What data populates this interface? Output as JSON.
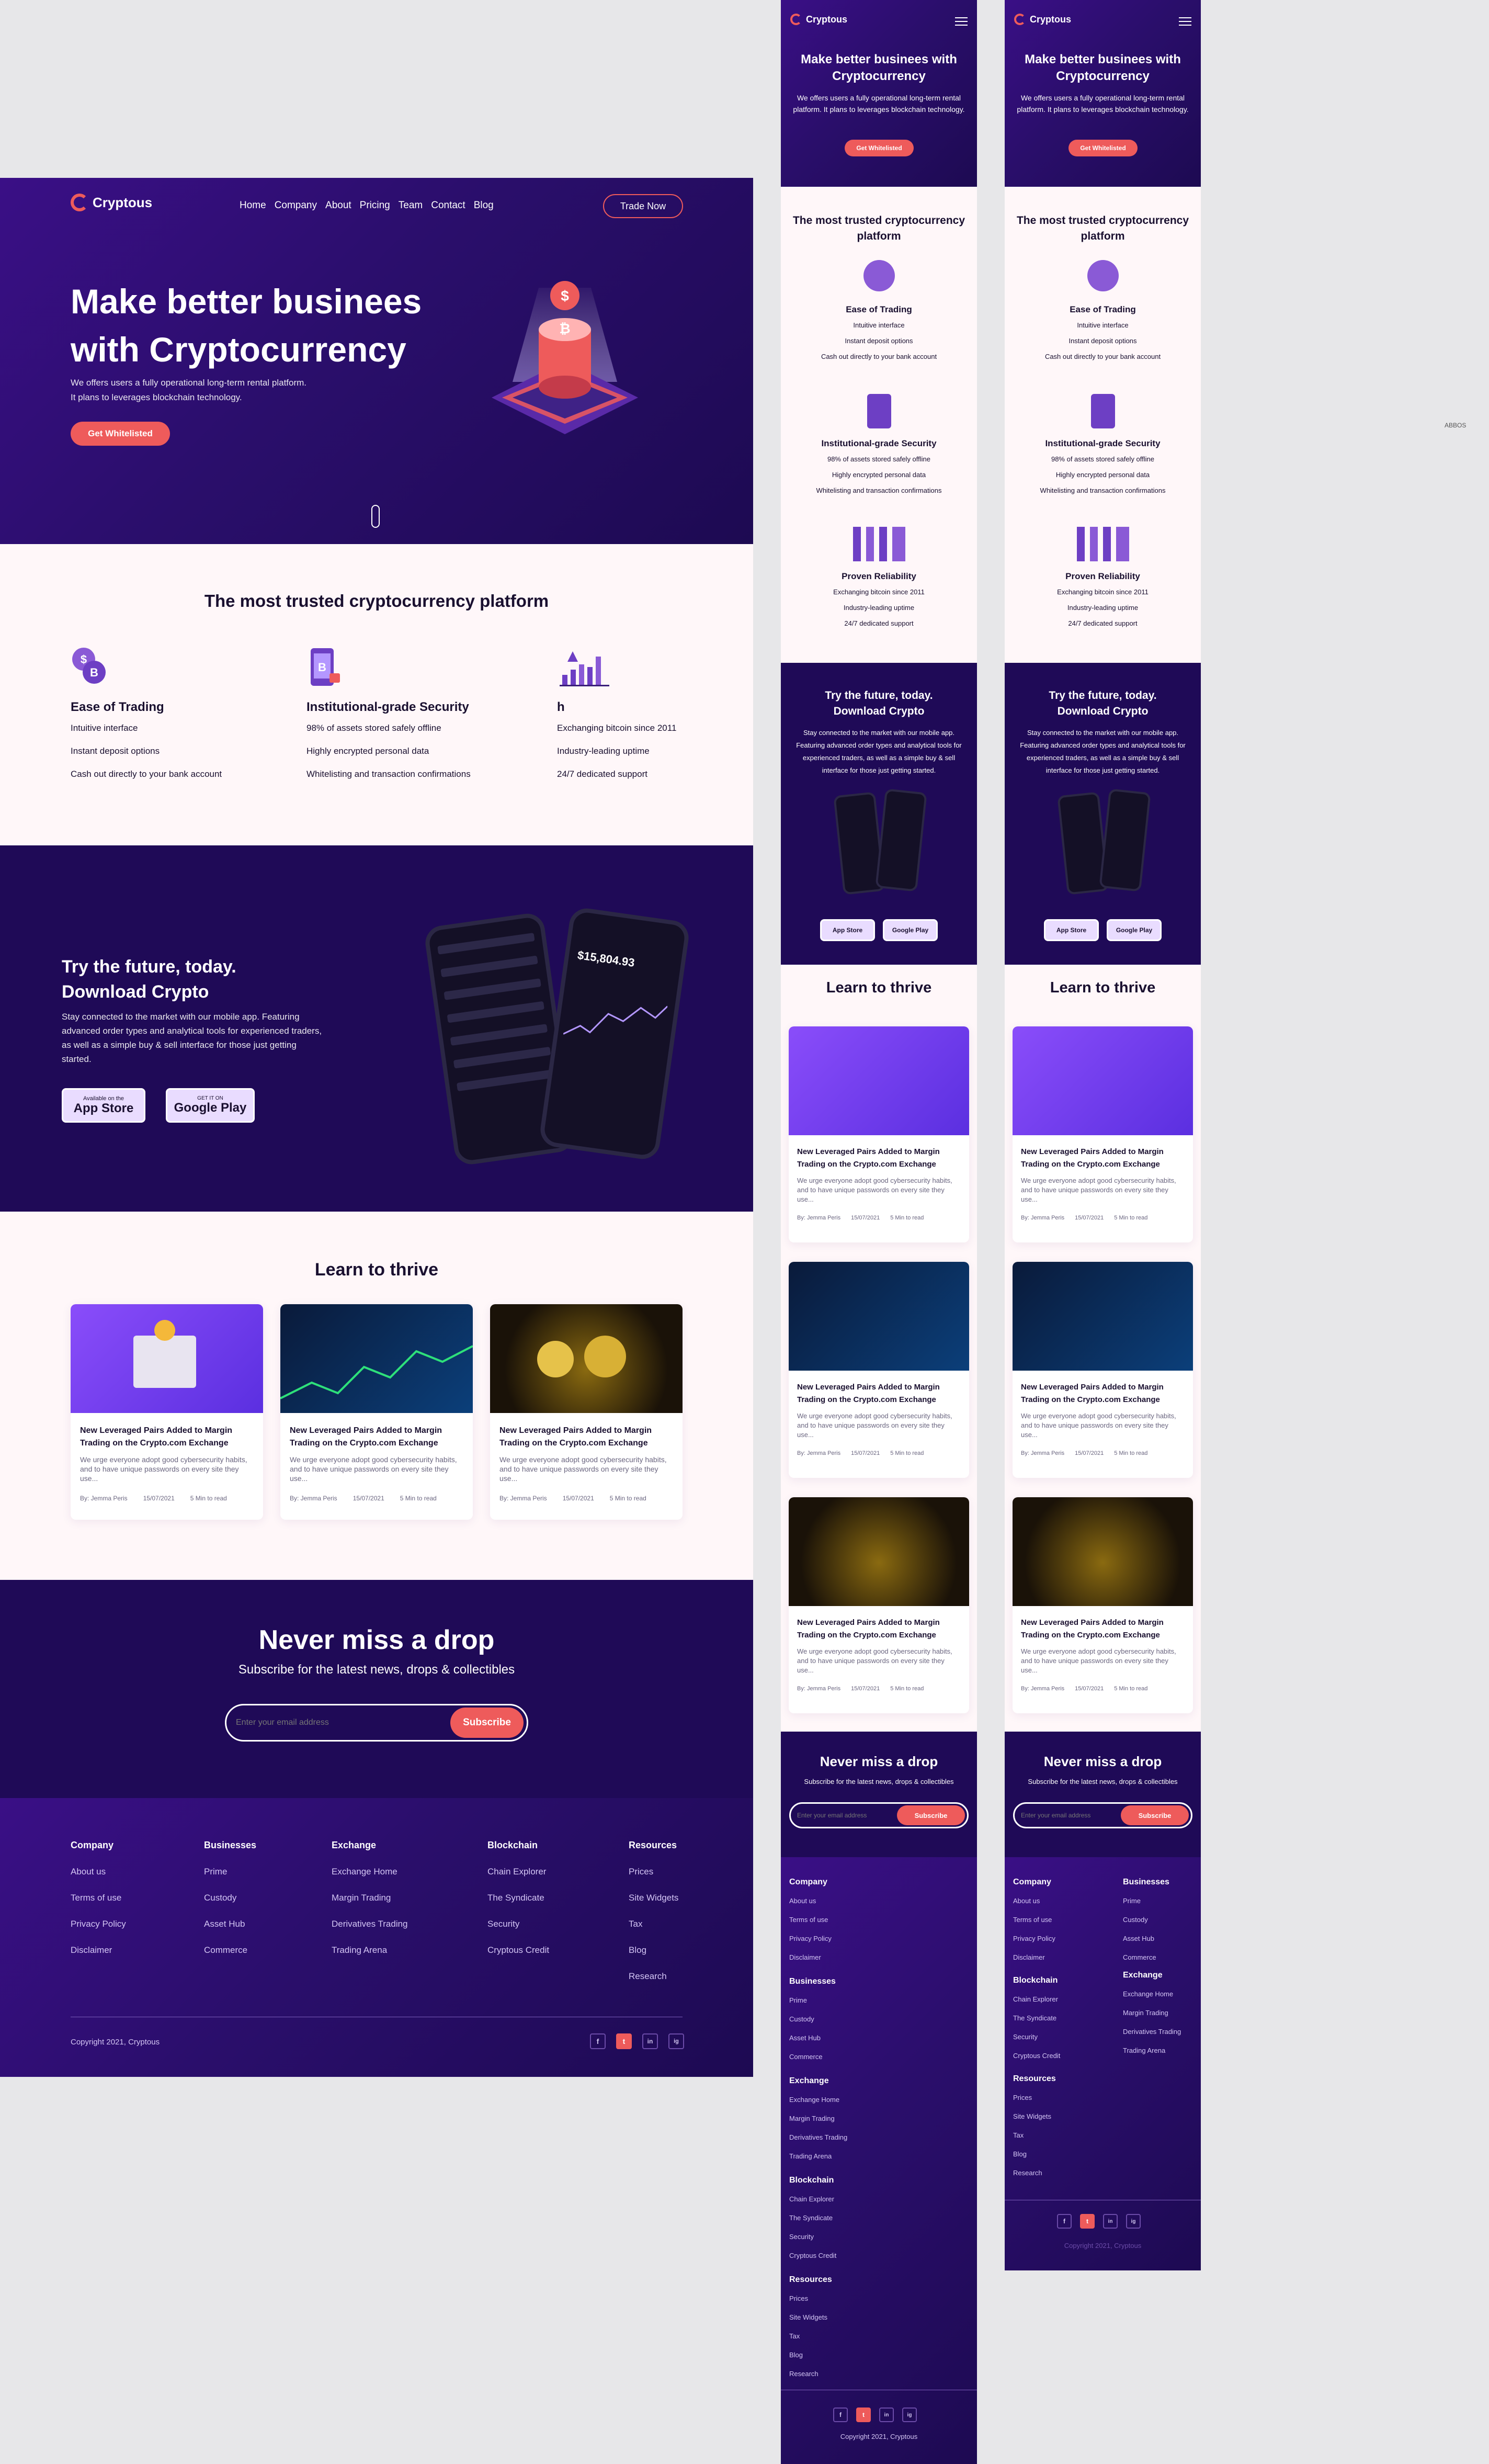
{
  "brand": {
    "name": "Cryptous"
  },
  "nav": {
    "items": [
      "Home",
      "Company",
      "About",
      "Pricing",
      "Team",
      "Contact",
      "Blog"
    ],
    "cta": "Trade Now"
  },
  "hero": {
    "title_line1": "Make better businees",
    "title_line2": "with Cryptocurrency",
    "mobile_title": "Make better businees with Cryptocurrency",
    "subtitle_line1": "We offers users a fully operational long-term rental platform.",
    "subtitle_line2": "It plans to leverages blockchain technology.",
    "mobile_subtitle": "We offers users a fully operational long-term rental platform. It plans to leverages blockchain technology.",
    "cta": "Get Whitelisted"
  },
  "features": {
    "heading": "The most trusted cryptocurrency platform",
    "items": [
      {
        "title": "Ease of Trading",
        "icon": "coins-icon",
        "lines": [
          "Intuitive interface",
          "Instant deposit options",
          "Cash out directly to your bank account"
        ]
      },
      {
        "title": "Institutional-grade Security",
        "icon": "phone-lock-icon",
        "lines": [
          "98% of assets stored safely offline",
          "Highly encrypted personal data",
          "Whitelisting and transaction confirmations"
        ]
      },
      {
        "title": "Proven Reliability",
        "desktop_title": "h",
        "icon": "rocket-chart-icon",
        "lines": [
          "Exchanging bitcoin since 2011",
          "Industry-leading uptime",
          "24/7 dedicated support"
        ]
      }
    ]
  },
  "app": {
    "title_line1": "Try the future, today.",
    "title_line2": "Download Crypto",
    "text": "Stay connected to the market with our mobile app. Featuring advanced order types and analytical tools for experienced traders, as well as a simple buy & sell interface for those just getting started.",
    "app_store": {
      "small": "Available on the",
      "big": "App Store"
    },
    "google_play": {
      "small": "GET IT ON",
      "big": "Google Play"
    },
    "phone_price": "$15,804.93"
  },
  "learn": {
    "heading": "Learn to thrive",
    "cards": [
      {
        "title": "New Leveraged Pairs Added to Margin Trading on the Crypto.com Exchange",
        "text": "We urge everyone adopt good cybersecurity habits, and to have unique passwords on every site they use...",
        "author": "By: Jemma Peris",
        "date": "15/07/2021",
        "read": "5 Min to read",
        "img": "coins-stack"
      },
      {
        "title": "New Leveraged Pairs Added to Margin Trading on the Crypto.com Exchange",
        "text": "We urge everyone adopt good cybersecurity habits, and to have unique passwords on every site they use...",
        "author": "By: Jemma Peris",
        "date": "15/07/2021",
        "read": "5 Min to read",
        "img": "trading-phone"
      },
      {
        "title": "New Leveraged Pairs Added to Margin Trading on the Crypto.com Exchange",
        "text": "We urge everyone adopt good cybersecurity habits, and to have unique passwords on every site they use...",
        "author": "By: Jemma Peris",
        "date": "15/07/2021",
        "read": "5 Min to read",
        "img": "gold-coins"
      }
    ]
  },
  "subscribe": {
    "heading": "Never miss a drop",
    "text": "Subscribe for the latest news, drops & collectibles",
    "placeholder": "Enter your email address",
    "button": "Subscribe"
  },
  "footer": {
    "columns": [
      {
        "title": "Company",
        "links": [
          "About us",
          "Terms of use",
          "Privacy Policy",
          "Disclaimer"
        ]
      },
      {
        "title": "Businesses",
        "links": [
          "Prime",
          "Custody",
          "Asset Hub",
          "Commerce"
        ]
      },
      {
        "title": "Exchange",
        "links": [
          "Exchange Home",
          "Margin Trading",
          "Derivatives Trading",
          "Trading Arena"
        ]
      },
      {
        "title": "Blockchain",
        "links": [
          "Chain Explorer",
          "The Syndicate",
          "Security",
          "Cryptous Credit"
        ]
      },
      {
        "title": "Resources",
        "links": [
          "Prices",
          "Site Widgets",
          "Tax",
          "Blog",
          "Research"
        ]
      }
    ],
    "copyright": "Copyright 2021, Cryptous",
    "social": [
      "f",
      "t",
      "in",
      "ig"
    ]
  },
  "side_note": "ABBOS",
  "colors": {
    "accent": "#ee5b5b",
    "hero": "#3a0f86",
    "dark": "#1f0a57",
    "light": "#fff7f9"
  }
}
